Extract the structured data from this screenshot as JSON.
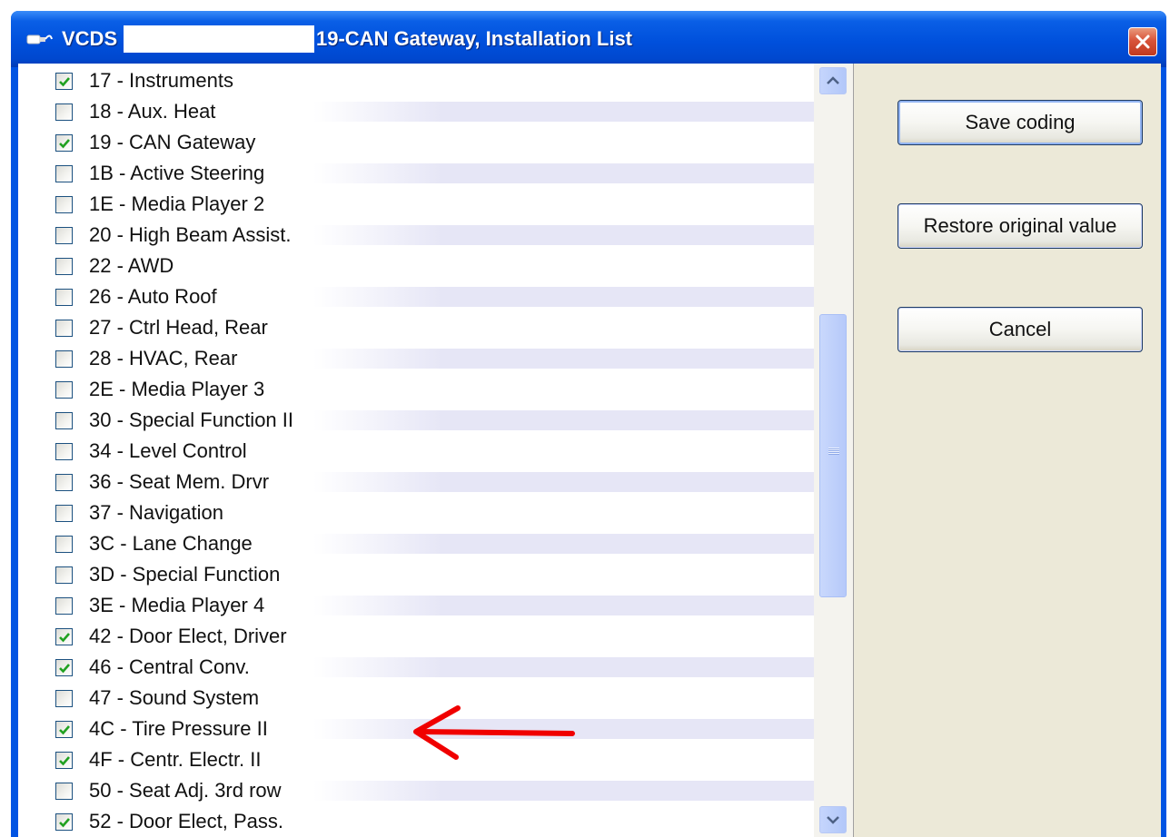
{
  "window": {
    "app_name": "VCDS",
    "title": "19-CAN Gateway,  Installation List"
  },
  "colors": {
    "titlebar": "#0054e3",
    "close_button": "#d8543a",
    "check": "#21a121",
    "arrow": "#f00000",
    "panel": "#ece9d8"
  },
  "modules": [
    {
      "label": "17 - Instruments",
      "checked": true
    },
    {
      "label": "18 - Aux. Heat",
      "checked": false
    },
    {
      "label": "19 - CAN Gateway",
      "checked": true
    },
    {
      "label": "1B - Active Steering",
      "checked": false
    },
    {
      "label": "1E - Media Player 2",
      "checked": false
    },
    {
      "label": "20 - High Beam Assist.",
      "checked": false
    },
    {
      "label": "22 - AWD",
      "checked": false
    },
    {
      "label": "26 - Auto Roof",
      "checked": false
    },
    {
      "label": "27 - Ctrl Head, Rear",
      "checked": false
    },
    {
      "label": "28 - HVAC, Rear",
      "checked": false
    },
    {
      "label": "2E - Media Player 3",
      "checked": false
    },
    {
      "label": "30 - Special Function II",
      "checked": false
    },
    {
      "label": "34 - Level Control",
      "checked": false
    },
    {
      "label": "36 - Seat Mem. Drvr",
      "checked": false
    },
    {
      "label": "37 - Navigation",
      "checked": false
    },
    {
      "label": "3C - Lane Change",
      "checked": false
    },
    {
      "label": "3D - Special Function",
      "checked": false
    },
    {
      "label": "3E - Media Player 4",
      "checked": false
    },
    {
      "label": "42 - Door Elect, Driver",
      "checked": true
    },
    {
      "label": "46 - Central Conv.",
      "checked": true
    },
    {
      "label": "47 - Sound System",
      "checked": false
    },
    {
      "label": "4C - Tire Pressure II",
      "checked": true
    },
    {
      "label": "4F - Centr. Electr. II",
      "checked": true
    },
    {
      "label": "50 - Seat Adj. 3rd row",
      "checked": false
    },
    {
      "label": "52 - Door Elect, Pass.",
      "checked": true
    }
  ],
  "buttons": {
    "save": "Save coding",
    "restore": "Restore original value",
    "cancel": "Cancel"
  },
  "icons": {
    "app": "vcds-cable-icon",
    "close": "close-icon",
    "scroll_up": "scroll-up-arrow-icon",
    "scroll_down": "scroll-down-arrow-icon",
    "annotation": "red-arrow-annotation"
  }
}
